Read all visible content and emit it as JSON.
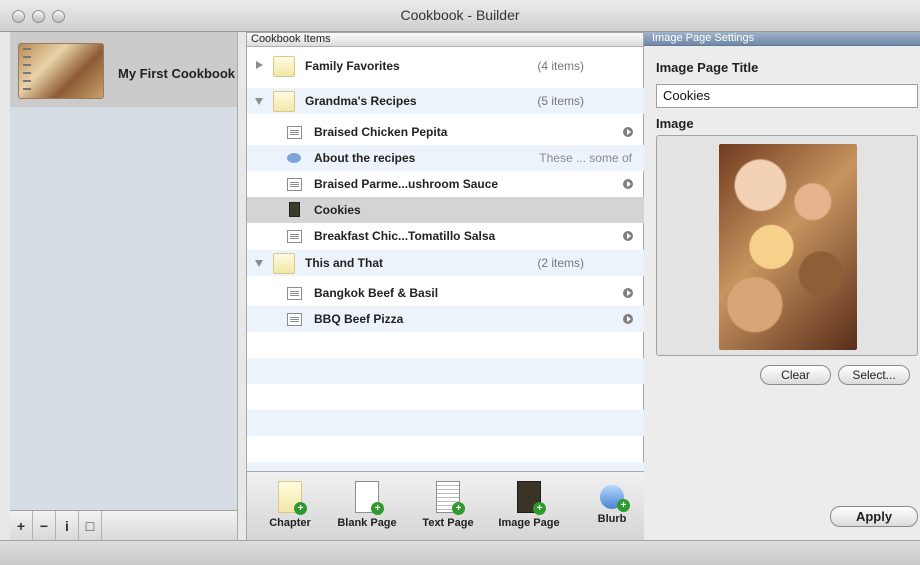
{
  "window": {
    "title": "Cookbook - Builder"
  },
  "sidebar": {
    "book_title": "My First Cookbook",
    "tools": [
      "+",
      "−",
      "i",
      "□"
    ]
  },
  "middle": {
    "header": "Cookbook Items",
    "rows": [
      {
        "type": "chapter",
        "label": "Family Favorites",
        "count": "(4 items)"
      },
      {
        "type": "chapter",
        "label": "Grandma's Recipes",
        "count": "(5 items)"
      },
      {
        "type": "page",
        "label": "Braised Chicken Pepita"
      },
      {
        "type": "blurb",
        "label": "About the recipes",
        "excerpt": "These ... some of"
      },
      {
        "type": "page",
        "label": "Braised Parme...ushroom Sauce"
      },
      {
        "type": "image",
        "label": "Cookies"
      },
      {
        "type": "page",
        "label": "Breakfast Chic...Tomatillo Salsa"
      },
      {
        "type": "chapter",
        "label": "This and That",
        "count": "(2 items)"
      },
      {
        "type": "page",
        "label": "Bangkok Beef & Basil"
      },
      {
        "type": "page",
        "label": "BBQ Beef Pizza"
      }
    ],
    "toolbar": [
      "Chapter",
      "Blank Page",
      "Text Page",
      "Image Page",
      "Blurb"
    ]
  },
  "right": {
    "header": "Image Page Settings",
    "title_label": "Image Page Title",
    "title_value": "Cookies",
    "image_label": "Image",
    "clear_btn": "Clear",
    "select_btn": "Select...",
    "apply_btn": "Apply"
  }
}
